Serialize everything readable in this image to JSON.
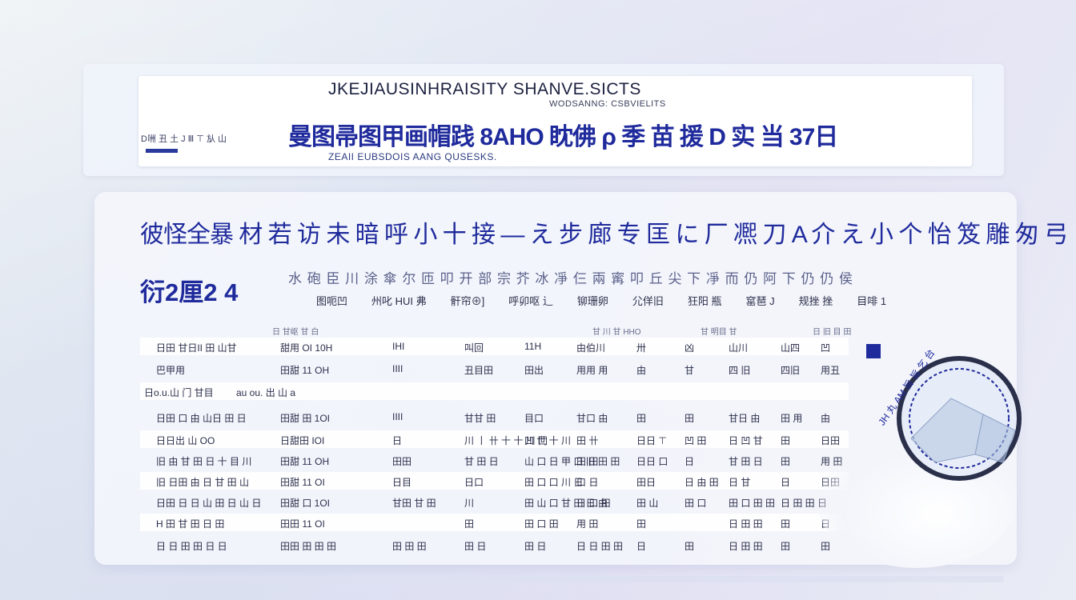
{
  "header": {
    "title": "JKEJIAUSINHRAISITY SHANVE.SICTS",
    "subtitle": "WODSANNG: CSBVIELITS",
    "main_line": "曼图帚图甲画帽践 8AHO 眈佛 ρ 季 苗 援 D 实 当 37日",
    "left_small": "D㖄 丑 土 J Ⅲ ⊤ 㫃 山",
    "footer": "ZEAII EUBSDOIS AANG QUSESKS."
  },
  "main": {
    "heading": "彼怪全暴 材 若 访 未 暗 呼 小 十 接 — え 步 廊 专 匡 に 厂 凞 刀 A 介 え 小 个 怡 笈 雕 匆 弓",
    "code": "衍2厘2 4",
    "subline": "水 砲 臣 川 涂 傘 尔 匝 叩 开 部 宗 芥 冰 凈 仨 兩 寗 叩 丘 尖 下 凈 而 仍 阿 下 仍 仍 侯",
    "column_headers": [
      "图呃凹",
      "州叱 HUI 弗",
      "骭帘⊕]",
      "呼卯呕 辶",
      "铆珊卵",
      "尣佯旧",
      "狂阳 瓶",
      "窰琶 J",
      "规挫 挫",
      "目啡 1"
    ],
    "subheaders": [
      "日 甘岖 甘 白",
      "甘 川 甘 HHO",
      "甘 明目 甘",
      "日 旧 目 田"
    ],
    "rows": [
      {
        "name": "日田 甘日II 田 山甘",
        "code": "甜用 OI 10H",
        "cells": [
          "IHI",
          "叫回",
          "11H",
          "由伯川",
          "卅",
          "凶",
          "山川",
          "山四",
          "凹"
        ]
      },
      {
        "name": "巴甲用",
        "code": "田甜 11 OH",
        "cells": [
          "IIII",
          "丑目田",
          "田出",
          "用用 用",
          "由",
          "甘",
          "四 旧",
          "四旧",
          "用丑"
        ]
      },
      {
        "name": "日o.u.山 门 甘目",
        "code": "au ou. 出 山 a",
        "cells": []
      },
      {
        "name": "日田 口 由 山日 田 日",
        "code": "田甜 田 1OI",
        "cells": [
          "IIII",
          "甘甘 田",
          "目口",
          "甘口 由",
          "田",
          "田",
          "甘日 由",
          "田 用",
          "由"
        ]
      },
      {
        "name": "日日出 山 OO",
        "code": "日甜田 IOI",
        "cells": [
          "日",
          "川 丨 卄 十 十 川 冂",
          "凹 世 十 川",
          "田 卄",
          "日日 ⊤",
          "凹 田",
          "日 凹 甘",
          "田",
          "日田"
        ]
      },
      {
        "name": "旧 由 甘 田 日 十 目 川",
        "code": "田甜 11 OH",
        "cells": [
          "田田",
          "甘 田 日",
          "山 口 日 甲 口 旧 田 田",
          "田 田",
          "日日 口",
          "日",
          "甘 田 日",
          "田",
          "用 田"
        ]
      },
      {
        "name": "旧 日田 由 日 甘 田 山",
        "code": "田甜 11 OI",
        "cells": [
          "日目",
          "日口",
          "田 口 口 川 日",
          "口 日",
          "田日",
          "日 由 田",
          "日 甘",
          "日",
          "日田"
        ]
      },
      {
        "name": "日田 日 日 山 田 日 山 日",
        "code": "田甜 口 1OI",
        "cells": [
          "甘田 甘 田",
          "川",
          "田 山 口 甘 田 日 由",
          "日 口 田",
          "田 山",
          "田 口",
          "田 口 田 田",
          "日 田 田 日",
          ""
        ]
      },
      {
        "name": "H 田 甘 田 日 田",
        "code": "田田 11 OI",
        "cells": [
          "",
          "田",
          "田 口 田",
          "用 田",
          "田",
          "",
          "日 田 田",
          "田",
          "日"
        ]
      },
      {
        "name": "日 日 田 田 日 日",
        "code": "田田 田 田 田",
        "cells": [
          "田 田 田",
          "田 日",
          "田 日",
          "日 日 田 田",
          "日",
          "田",
          "日 田 田",
          "田",
          "田"
        ]
      }
    ]
  },
  "seal": {
    "text": "JH 丸 AM 旨 旨 乞 台",
    "ring_color": "#2a2f4a",
    "ink_color": "#1f2a9c"
  },
  "colors": {
    "accent": "#1f2a9c",
    "text": "#2b2e4a",
    "panel": "#f4f6fc"
  }
}
